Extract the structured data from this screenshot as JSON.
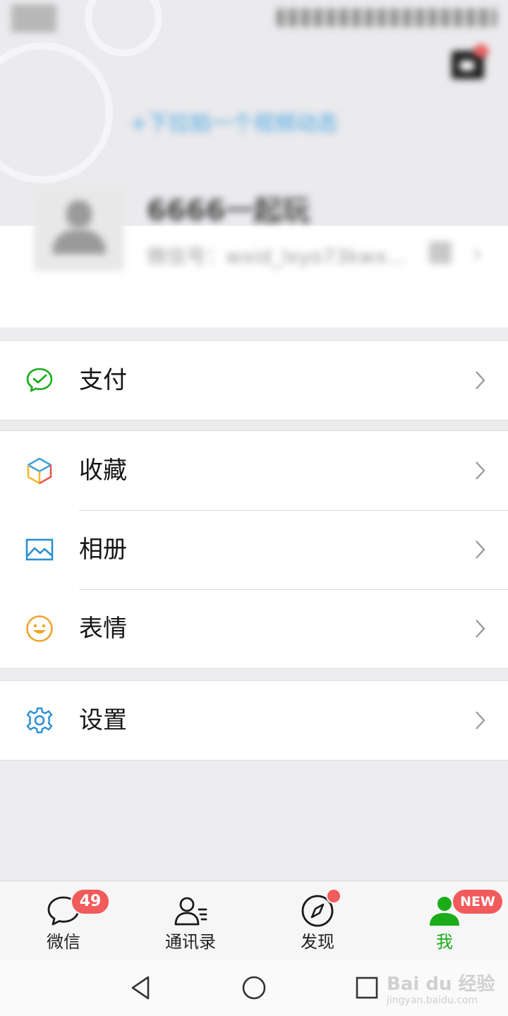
{
  "status_bar": {
    "time_icon": "blurred-time",
    "indicators_icon": "blurred-status-icons"
  },
  "header": {
    "camera_icon": "camera-icon",
    "status_link": "+下拉拍一个视频动态"
  },
  "profile": {
    "nickname": "6666一起玩",
    "wechat_id": "微信号：wxid_lxyo73kwx...",
    "avatar_icon": "default-avatar-icon",
    "qr_icon": "qr-code-icon",
    "chevron": "›"
  },
  "menu": {
    "sections": [
      {
        "items": [
          {
            "label": "支付",
            "icon": "wechat-pay-icon"
          }
        ]
      },
      {
        "items": [
          {
            "label": "收藏",
            "icon": "favorites-cube-icon"
          },
          {
            "label": "相册",
            "icon": "album-picture-icon"
          },
          {
            "label": "表情",
            "icon": "sticker-smile-icon"
          }
        ]
      },
      {
        "items": [
          {
            "label": "设置",
            "icon": "settings-gear-icon"
          }
        ]
      }
    ]
  },
  "tabbar": {
    "tabs": [
      {
        "label": "微信",
        "icon": "chat-bubble-icon",
        "badge": "49"
      },
      {
        "label": "通讯录",
        "icon": "contacts-icon"
      },
      {
        "label": "发现",
        "icon": "compass-icon",
        "dot": true
      },
      {
        "label": "我",
        "icon": "me-person-icon",
        "badge": "NEW",
        "active": true
      }
    ]
  },
  "navbar": {
    "back_icon": "triangle-back-icon",
    "home_icon": "circle-home-icon",
    "recent_icon": "square-recent-icon"
  },
  "watermark": {
    "text": "Bai du 经验",
    "subtext": "jingyan.baidu.com"
  },
  "colors": {
    "accent_green": "#1aad19",
    "badge_red": "#f25b5b",
    "link_blue": "#49a7e0",
    "background": "#ededf0"
  }
}
